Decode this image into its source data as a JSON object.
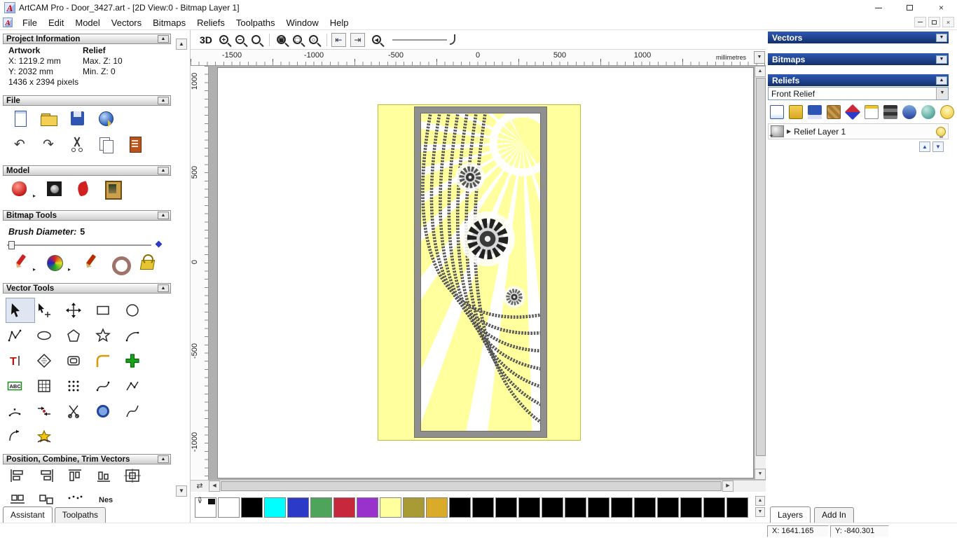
{
  "titlebar": {
    "title": "ArtCAM Pro - Door_3427.art - [2D View:0 - Bitmap Layer 1]"
  },
  "menubar": {
    "items": [
      "File",
      "Edit",
      "Model",
      "Vectors",
      "Bitmaps",
      "Reliefs",
      "Toolpaths",
      "Window",
      "Help"
    ]
  },
  "assistant": {
    "tabs": {
      "assistant": "Assistant",
      "toolpaths": "Toolpaths"
    },
    "project_information": {
      "title": "Project Information",
      "artwork_label": "Artwork",
      "relief_label": "Relief",
      "artwork_x": "X: 1219.2 mm",
      "artwork_y": "Y: 2032 mm",
      "artwork_pixels": "1436 x 2394 pixels",
      "relief_max_z": "Max. Z: 10",
      "relief_min_z": "Min. Z: 0"
    },
    "file_section": {
      "title": "File",
      "icons": [
        "new-model",
        "open-model",
        "save-model",
        "import-3d-model",
        "undo",
        "redo",
        "cut",
        "paste",
        "notes"
      ]
    },
    "model_section": {
      "title": "Model",
      "icons": [
        "adjust-model",
        "greyscale-from-model",
        "relief-preview",
        "load-bitmap"
      ]
    },
    "bitmap_tools": {
      "title": "Bitmap Tools",
      "brush_diameter_label": "Brush Diameter:",
      "brush_diameter_value": "5",
      "icons": [
        "draw",
        "colour-swirl",
        "paint-brush",
        "eraser-ring",
        "flood-fill"
      ]
    },
    "vector_tools": {
      "title": "Vector Tools",
      "icons": [
        "select-vectors",
        "node-editing",
        "transform-vectors",
        "create-rectangle",
        "create-circle",
        "create-polyline",
        "create-ellipse",
        "create-polygon",
        "create-star",
        "create-arc",
        "create-text",
        "wrap-text",
        "offset-vectors",
        "fillet-vectors",
        "block-paste",
        "text-abc",
        "measure",
        "paste-array",
        "fit-curve",
        "fit-polyline",
        "fit-arc",
        "join-vectors",
        "trim-vectors",
        "create-interpolated",
        "fit-spline",
        "mirror-vectors",
        "wrap-vectors"
      ]
    },
    "position_section": {
      "title": "Position, Combine, Trim Vectors",
      "icons": [
        "align-left",
        "align-right",
        "align-top",
        "align-bottom",
        "align-centre"
      ],
      "partial_label": "Nes"
    }
  },
  "view2d": {
    "toolbar": {
      "btn_3d": "3D",
      "icons": [
        "zoom-in",
        "zoom-out",
        "zoom-box",
        "zoom-fit",
        "zoom-object",
        "zoom-scale",
        "snap-left",
        "snap-right",
        "zoom-previous",
        "line-smoothing"
      ]
    },
    "h_ruler": {
      "labels": [
        "-1500",
        "-1000",
        "-500",
        "0",
        "500",
        "1000"
      ],
      "units": "millimetres"
    },
    "v_ruler": {
      "labels": [
        "1000",
        "500",
        "0",
        "-500",
        "-1000"
      ]
    }
  },
  "palette": {
    "colors": [
      "#FFFFFF",
      "#FFFFFF",
      "#000000",
      "#00FFFF",
      "#2B3BC8",
      "#4FA45C",
      "#C8283C",
      "#9932CC",
      "#FFFF9E",
      "#A89A35",
      "#DAAB28",
      "#000000",
      "#000000",
      "#000000",
      "#000000",
      "#000000",
      "#000000",
      "#000000",
      "#000000",
      "#000000",
      "#000000",
      "#000000",
      "#000000",
      "#000000"
    ]
  },
  "right_panel": {
    "vectors_title": "Vectors",
    "bitmaps_title": "Bitmaps",
    "reliefs_title": "Reliefs",
    "relief_name": "Front Relief",
    "relief_toolbar_icons": [
      "new-relief",
      "open-relief",
      "save-relief",
      "texture-relief",
      "sculpt-relief",
      "paste-relief",
      "greyscale-relief",
      "transfer-relief",
      "smooth-relief",
      "toggle-visibility"
    ],
    "layer": {
      "name": "Relief Layer 1"
    },
    "tabs": {
      "layers": "Layers",
      "addin": "Add In"
    }
  },
  "statusbar": {
    "x": "X: 1641.165",
    "y": "Y: -840.301"
  }
}
